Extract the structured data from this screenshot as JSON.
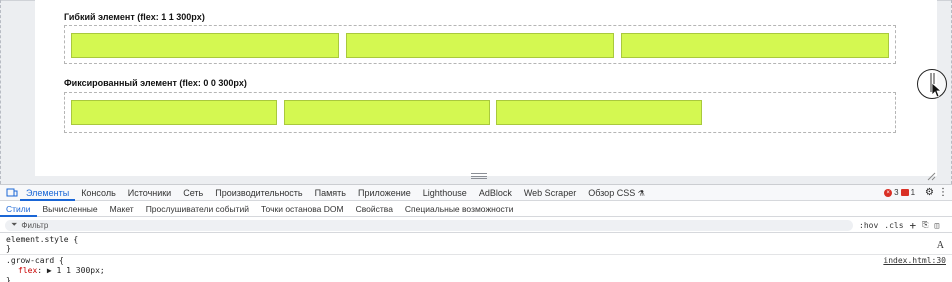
{
  "page": {
    "section1_title": "Гибкий элемент (flex: 1 1 300px)",
    "section2_title": "Фиксированный элемент (flex: 0 0 300px)",
    "card_color": "#d4f851"
  },
  "devtools": {
    "main_tabs": [
      {
        "label": "Элементы",
        "active": true
      },
      {
        "label": "Консоль"
      },
      {
        "label": "Источники"
      },
      {
        "label": "Сеть"
      },
      {
        "label": "Производительность"
      },
      {
        "label": "Память"
      },
      {
        "label": "Приложение"
      },
      {
        "label": "Lighthouse"
      },
      {
        "label": "AdBlock"
      },
      {
        "label": "Web Scraper"
      },
      {
        "label": "Обзор CSS"
      }
    ],
    "error_count": "3",
    "message_count": "1",
    "sub_tabs": [
      {
        "label": "Стили",
        "active": true
      },
      {
        "label": "Вычисленные"
      },
      {
        "label": "Макет"
      },
      {
        "label": "Прослушиватели событий"
      },
      {
        "label": "Точки останова DOM"
      },
      {
        "label": "Свойства"
      },
      {
        "label": "Специальные возможности"
      }
    ],
    "filter_placeholder": "Фильтр",
    "hov_label": ":hov",
    "cls_label": ".cls",
    "styles": {
      "element_style_selector": "element.style {",
      "element_style_close": "}",
      "rule_selector": ".grow-card {",
      "prop_name": "flex",
      "prop_value": "▶ 1 1 300px;",
      "rule_close": "}",
      "source": "index.html:30"
    },
    "font_button": "A"
  }
}
